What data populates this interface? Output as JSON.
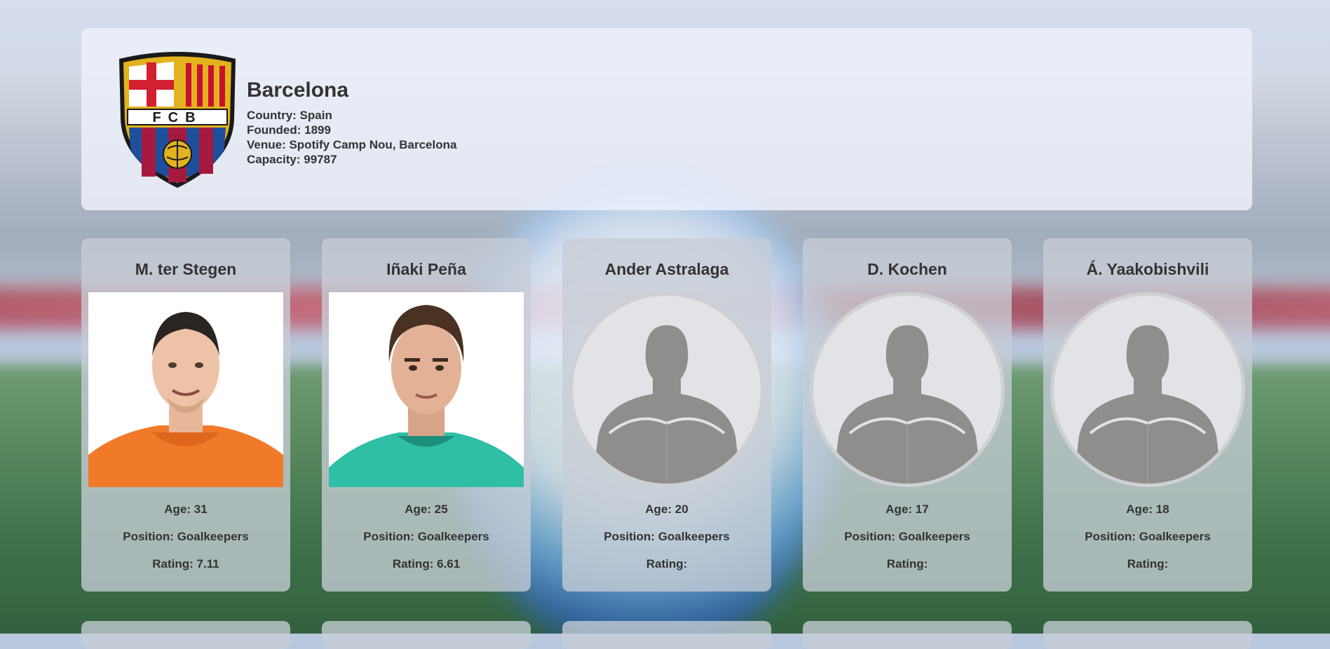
{
  "team": {
    "name": "Barcelona",
    "country": "Country: Spain",
    "founded": "Founded: 1899",
    "venue": "Venue: Spotify Camp Nou, Barcelona",
    "capacity": "Capacity: 99787",
    "crest_text": "FCB",
    "colors": {
      "blaugrana_blue": "#1d4f9c",
      "blaugrana_red": "#a6193e",
      "gold": "#e3b21f"
    }
  },
  "players": [
    {
      "name": "M. ter Stegen",
      "age": "Age: 31",
      "position": "Position: Goalkeepers",
      "rating": "Rating: 7.11",
      "photo": "player-photo",
      "kit_color": "#f07a2a"
    },
    {
      "name": "Iñaki Peña",
      "age": "Age: 25",
      "position": "Position: Goalkeepers",
      "rating": "Rating: 6.61",
      "photo": "player-photo",
      "kit_color": "#2fbfa6"
    },
    {
      "name": "Ander Astralaga",
      "age": "Age: 20",
      "position": "Position: Goalkeepers",
      "rating": "Rating:",
      "photo": "placeholder-avatar-icon"
    },
    {
      "name": "D. Kochen",
      "age": "Age: 17",
      "position": "Position: Goalkeepers",
      "rating": "Rating:",
      "photo": "placeholder-avatar-icon"
    },
    {
      "name": "Á. Yaakobishvili",
      "age": "Age: 18",
      "position": "Position: Goalkeepers",
      "rating": "Rating:",
      "photo": "placeholder-avatar-icon"
    }
  ]
}
